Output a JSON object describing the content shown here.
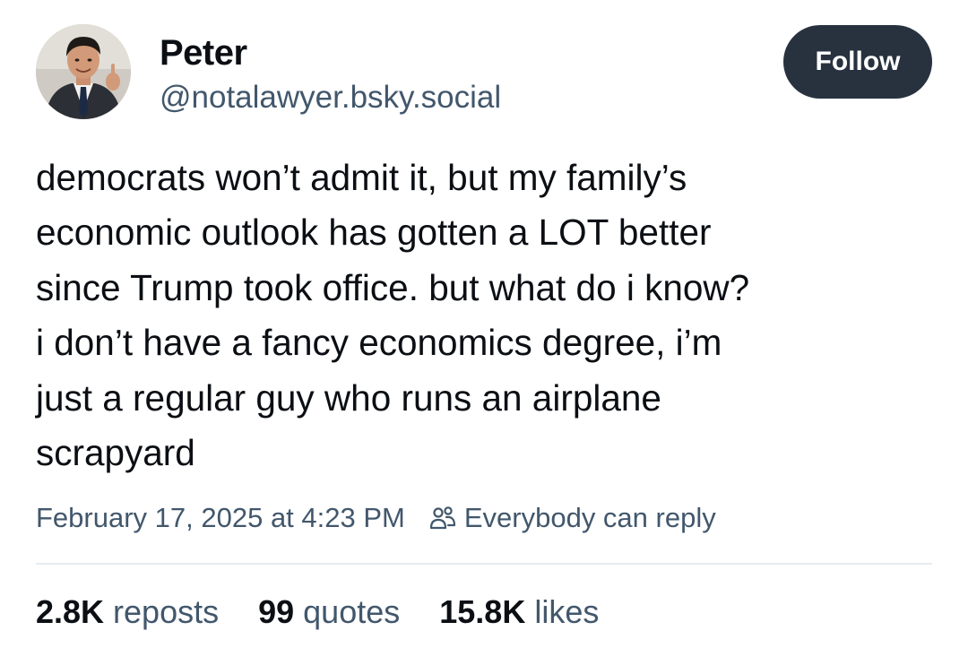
{
  "author": {
    "display_name": "Peter",
    "handle": "@notalawyer.bsky.social"
  },
  "follow_button": {
    "label": "Follow"
  },
  "post": {
    "text_lines": [
      "democrats won’t admit it, but my family’s",
      "economic outlook has gotten a LOT better",
      "since Trump took office. but what do i know?",
      "i don’t have a fancy economics degree, i’m",
      "just a regular guy who runs an airplane",
      "scrapyard"
    ],
    "timestamp": "February 17, 2025 at 4:23 PM",
    "reply_setting": "Everybody can reply",
    "reply_setting_icon": "people-icon"
  },
  "stats": {
    "reposts": {
      "count": "2.8K",
      "label": "reposts"
    },
    "quotes": {
      "count": "99",
      "label": "quotes"
    },
    "likes": {
      "count": "15.8K",
      "label": "likes"
    }
  },
  "colors": {
    "text_primary": "#0b0f14",
    "text_secondary": "#42576c",
    "follow_button_bg": "#28323f",
    "divider": "#e6ebf0"
  }
}
